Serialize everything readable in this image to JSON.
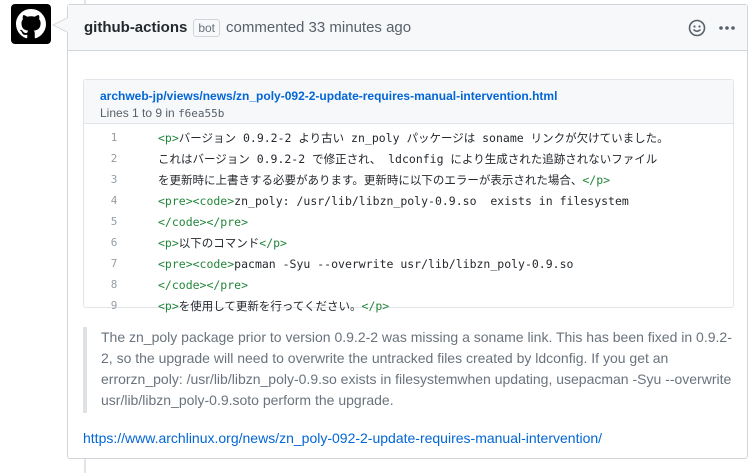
{
  "comment": {
    "author": "github-actions",
    "badge": "bot",
    "action": "commented 33 minutes ago",
    "icons": [
      "github-octocat-icon",
      "smiley-icon",
      "kebab-icon"
    ]
  },
  "file": {
    "path": "archweb-jp/views/news/zn_poly-092-2-update-requires-manual-intervention.html",
    "lines_text": "Lines 1 to 9 in",
    "sha": "f6ea55b",
    "lines": [
      {
        "num": "1",
        "parts": [
          {
            "t": "<p>",
            "tag": true
          },
          {
            "t": "バージョン 0.9.2-2 より古い zn_poly パッケージは soname リンクが欠けていました。",
            "tag": false
          }
        ]
      },
      {
        "num": "2",
        "parts": [
          {
            "t": "これはバージョン 0.9.2-2 で修正され、 ldconfig により生成された追跡されないファイル",
            "tag": false
          }
        ]
      },
      {
        "num": "3",
        "parts": [
          {
            "t": "を更新時に上書きする必要があります。更新時に以下のエラーが表示された場合、",
            "tag": false
          },
          {
            "t": "</p>",
            "tag": true
          }
        ]
      },
      {
        "num": "4",
        "parts": [
          {
            "t": "<pre><code>",
            "tag": true
          },
          {
            "t": "zn_poly: /usr/lib/libzn_poly-0.9.so  exists in filesystem",
            "tag": false
          }
        ]
      },
      {
        "num": "5",
        "parts": [
          {
            "t": "</code></pre>",
            "tag": true
          }
        ]
      },
      {
        "num": "6",
        "parts": [
          {
            "t": "<p>",
            "tag": true
          },
          {
            "t": "以下のコマンド",
            "tag": false
          },
          {
            "t": "</p>",
            "tag": true
          }
        ]
      },
      {
        "num": "7",
        "parts": [
          {
            "t": "<pre><code>",
            "tag": true
          },
          {
            "t": "pacman -Syu --overwrite usr/lib/libzn_poly-0.9.so",
            "tag": false
          }
        ]
      },
      {
        "num": "8",
        "parts": [
          {
            "t": "</code></pre>",
            "tag": true
          }
        ]
      },
      {
        "num": "9",
        "parts": [
          {
            "t": "<p>",
            "tag": true
          },
          {
            "t": "を使用して更新を行ってください。",
            "tag": false
          },
          {
            "t": "</p>",
            "tag": true
          }
        ]
      }
    ]
  },
  "quote": {
    "text": "The zn_poly package prior to version 0.9.2-2 was missing a soname link. This has been fixed in 0.9.2-2, so the upgrade will need to overwrite the untracked files created by ldconfig. If you get an errorzn_poly: /usr/lib/libzn_poly-0.9.so exists in filesystemwhen updating, usepacman -Syu --overwrite usr/lib/libzn_poly-0.9.soto perform the upgrade."
  },
  "link": {
    "url": "https://www.archlinux.org/news/zn_poly-092-2-update-requires-manual-intervention/"
  },
  "colors": {
    "link": "#0366d6",
    "tag": "#22863a",
    "muted": "#6a737d"
  }
}
